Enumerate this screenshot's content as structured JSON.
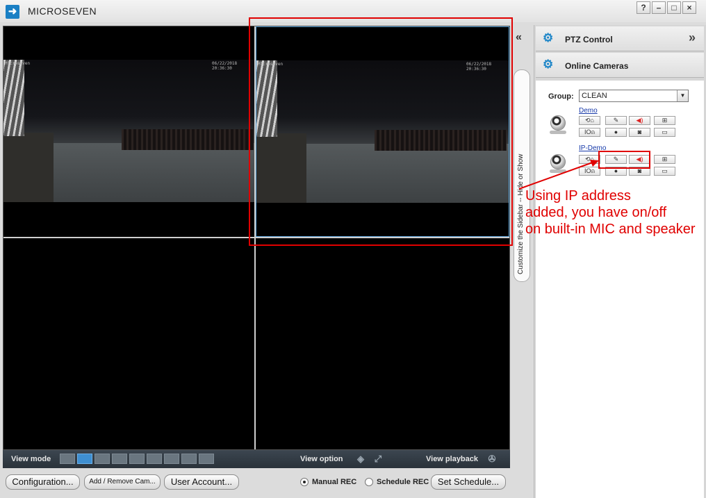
{
  "app": {
    "title": "MICROSEVEN",
    "logo": "arrow-logo-icon"
  },
  "window_controls": [
    "?",
    "–",
    "□",
    "×"
  ],
  "video": {
    "osd_name": "Microseven",
    "osd_time": "06/22/2018 20:36:30"
  },
  "viewbar": {
    "view_mode": "View mode",
    "view_option": "View option",
    "view_playback": "View playback"
  },
  "bottom": {
    "configuration": "Configuration...",
    "add_remove": "Add / Remove Cam...",
    "user_account": "User Account...",
    "manual_rec": "Manual REC",
    "schedule_rec": "Schedule REC",
    "set_schedule": "Set Schedule..."
  },
  "sidebar_tab": "Customize the Sidebar -- Hide or Show",
  "panel": {
    "ptz_title": "PTZ Control",
    "online_title": "Online Cameras",
    "group_label": "Group:",
    "group_value": "CLEAN",
    "cameras": [
      {
        "name": "Demo"
      },
      {
        "name": "IP-Demo"
      }
    ]
  },
  "annotation": {
    "line1": "Using IP address",
    "line2": "added, you have on/off",
    "line3": "on built-in MIC and speaker"
  },
  "colors": {
    "accent": "#1e86c8",
    "annotation": "#e00000",
    "selected_layout": "#3f8fd1"
  }
}
